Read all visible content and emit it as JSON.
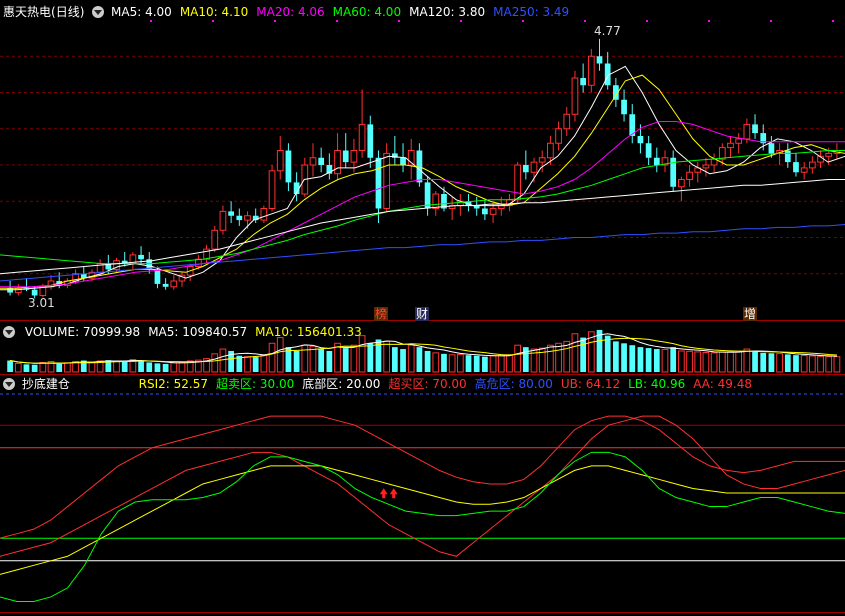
{
  "header": {
    "stock_name": "惠天热电",
    "period": "(日线)",
    "ma_labels": [
      {
        "text": "MA5: 4.00",
        "color": "#ffffff"
      },
      {
        "text": "MA10: 4.10",
        "color": "#ffff00"
      },
      {
        "text": "MA20: 4.06",
        "color": "#ff00ff"
      },
      {
        "text": "MA60: 4.00",
        "color": "#00ff00"
      },
      {
        "text": "MA120: 3.80",
        "color": "#ffffff"
      },
      {
        "text": "MA250: 3.49",
        "color": "#3050ff"
      }
    ]
  },
  "price_annotations": {
    "high": "4.77",
    "low": "3.01"
  },
  "signal_markers": [
    "榜",
    "财",
    "增"
  ],
  "volume_header": [
    {
      "text": "VOLUME: 70999.98",
      "color": "#ffffff"
    },
    {
      "text": "MA5: 109840.57",
      "color": "#ffffff"
    },
    {
      "text": "MA10: 156401.33",
      "color": "#ffff00"
    }
  ],
  "indicator_header": {
    "name": "抄底建仓",
    "items": [
      {
        "text": "RSI2: 52.57",
        "color": "#ffff00"
      },
      {
        "text": "超卖区: 30.00",
        "color": "#00ff00"
      },
      {
        "text": "底部区: 20.00",
        "color": "#ffffff"
      },
      {
        "text": "超买区: 70.00",
        "color": "#ff3030"
      },
      {
        "text": "高危区: 80.00",
        "color": "#3050ff"
      },
      {
        "text": "UB: 64.12",
        "color": "#ff3030"
      },
      {
        "text": "LB: 40.96",
        "color": "#00ff00"
      },
      {
        "text": "AA: 49.48",
        "color": "#ff3030"
      }
    ]
  },
  "icons": [
    "collapse-triangle-icon",
    "buy-signal-arrow-icon"
  ],
  "colors": {
    "up": "#ff3030",
    "down": "#54ffff",
    "background": "#000000",
    "separator": "#a00000"
  },
  "chart_data": {
    "type": "candlestick",
    "price_ylim": [
      2.9,
      4.9
    ],
    "ohlc": [
      [
        3.05,
        3.1,
        3.0,
        3.02
      ],
      [
        3.02,
        3.08,
        3.0,
        3.05
      ],
      [
        3.05,
        3.12,
        3.03,
        3.04
      ],
      [
        3.04,
        3.06,
        2.98,
        3.0
      ],
      [
        3.0,
        3.08,
        2.99,
        3.06
      ],
      [
        3.06,
        3.14,
        3.04,
        3.1
      ],
      [
        3.1,
        3.16,
        3.05,
        3.07
      ],
      [
        3.07,
        3.12,
        3.05,
        3.1
      ],
      [
        3.1,
        3.18,
        3.08,
        3.15
      ],
      [
        3.15,
        3.2,
        3.1,
        3.12
      ],
      [
        3.12,
        3.18,
        3.1,
        3.16
      ],
      [
        3.16,
        3.25,
        3.14,
        3.22
      ],
      [
        3.22,
        3.28,
        3.15,
        3.18
      ],
      [
        3.18,
        3.26,
        3.16,
        3.24
      ],
      [
        3.24,
        3.3,
        3.2,
        3.22
      ],
      [
        3.22,
        3.3,
        3.18,
        3.28
      ],
      [
        3.28,
        3.34,
        3.22,
        3.25
      ],
      [
        3.25,
        3.3,
        3.15,
        3.18
      ],
      [
        3.18,
        3.2,
        3.05,
        3.08
      ],
      [
        3.08,
        3.12,
        3.04,
        3.06
      ],
      [
        3.06,
        3.14,
        3.04,
        3.1
      ],
      [
        3.1,
        3.16,
        3.06,
        3.14
      ],
      [
        3.14,
        3.22,
        3.1,
        3.2
      ],
      [
        3.2,
        3.28,
        3.18,
        3.25
      ],
      [
        3.25,
        3.35,
        3.22,
        3.32
      ],
      [
        3.32,
        3.48,
        3.3,
        3.45
      ],
      [
        3.45,
        3.62,
        3.42,
        3.58
      ],
      [
        3.58,
        3.65,
        3.5,
        3.55
      ],
      [
        3.55,
        3.6,
        3.48,
        3.52
      ],
      [
        3.52,
        3.58,
        3.46,
        3.55
      ],
      [
        3.55,
        3.6,
        3.5,
        3.52
      ],
      [
        3.52,
        3.62,
        3.5,
        3.6
      ],
      [
        3.6,
        3.9,
        3.58,
        3.86
      ],
      [
        3.86,
        4.1,
        3.8,
        4.0
      ],
      [
        4.0,
        4.05,
        3.72,
        3.78
      ],
      [
        3.78,
        3.85,
        3.65,
        3.7
      ],
      [
        3.7,
        3.95,
        3.68,
        3.9
      ],
      [
        3.9,
        4.05,
        3.82,
        3.95
      ],
      [
        3.95,
        4.02,
        3.85,
        3.9
      ],
      [
        3.9,
        3.98,
        3.8,
        3.84
      ],
      [
        3.84,
        4.12,
        3.8,
        4.0
      ],
      [
        4.0,
        4.12,
        3.88,
        3.92
      ],
      [
        3.92,
        4.08,
        3.85,
        4.0
      ],
      [
        4.0,
        4.42,
        3.95,
        4.18
      ],
      [
        4.18,
        4.24,
        3.88,
        3.95
      ],
      [
        3.95,
        4.0,
        3.5,
        3.6
      ],
      [
        3.6,
        4.05,
        3.58,
        3.98
      ],
      [
        3.98,
        4.1,
        3.9,
        3.95
      ],
      [
        3.95,
        4.05,
        3.85,
        3.9
      ],
      [
        3.9,
        4.08,
        3.8,
        4.0
      ],
      [
        4.0,
        4.05,
        3.75,
        3.78
      ],
      [
        3.78,
        3.82,
        3.55,
        3.6
      ],
      [
        3.6,
        3.72,
        3.55,
        3.7
      ],
      [
        3.7,
        3.75,
        3.58,
        3.6
      ],
      [
        3.6,
        3.68,
        3.52,
        3.62
      ],
      [
        3.62,
        3.7,
        3.55,
        3.65
      ],
      [
        3.65,
        3.7,
        3.58,
        3.62
      ],
      [
        3.62,
        3.68,
        3.55,
        3.6
      ],
      [
        3.6,
        3.66,
        3.52,
        3.56
      ],
      [
        3.56,
        3.64,
        3.5,
        3.6
      ],
      [
        3.6,
        3.68,
        3.55,
        3.62
      ],
      [
        3.62,
        3.7,
        3.58,
        3.66
      ],
      [
        3.66,
        3.92,
        3.64,
        3.9
      ],
      [
        3.9,
        4.0,
        3.8,
        3.85
      ],
      [
        3.85,
        3.95,
        3.78,
        3.92
      ],
      [
        3.92,
        4.0,
        3.85,
        3.95
      ],
      [
        3.95,
        4.1,
        3.9,
        4.05
      ],
      [
        4.05,
        4.2,
        4.0,
        4.15
      ],
      [
        4.15,
        4.3,
        4.1,
        4.25
      ],
      [
        4.25,
        4.55,
        4.2,
        4.5
      ],
      [
        4.5,
        4.6,
        4.4,
        4.45
      ],
      [
        4.45,
        4.7,
        4.4,
        4.65
      ],
      [
        4.65,
        4.77,
        4.55,
        4.6
      ],
      [
        4.6,
        4.68,
        4.42,
        4.45
      ],
      [
        4.45,
        4.5,
        4.3,
        4.35
      ],
      [
        4.35,
        4.42,
        4.2,
        4.25
      ],
      [
        4.25,
        4.32,
        4.05,
        4.1
      ],
      [
        4.1,
        4.18,
        3.98,
        4.05
      ],
      [
        4.05,
        4.1,
        3.9,
        3.95
      ],
      [
        3.95,
        4.02,
        3.85,
        3.9
      ],
      [
        3.9,
        4.0,
        3.85,
        3.95
      ],
      [
        3.95,
        4.0,
        3.72,
        3.75
      ],
      [
        3.75,
        3.82,
        3.65,
        3.8
      ],
      [
        3.8,
        3.9,
        3.75,
        3.85
      ],
      [
        3.85,
        3.92,
        3.78,
        3.88
      ],
      [
        3.88,
        3.95,
        3.82,
        3.9
      ],
      [
        3.9,
        3.98,
        3.85,
        3.94
      ],
      [
        3.94,
        4.05,
        3.9,
        4.02
      ],
      [
        4.02,
        4.1,
        3.95,
        4.05
      ],
      [
        4.05,
        4.12,
        3.98,
        4.08
      ],
      [
        4.08,
        4.22,
        4.05,
        4.18
      ],
      [
        4.18,
        4.25,
        4.08,
        4.12
      ],
      [
        4.12,
        4.18,
        4.0,
        4.05
      ],
      [
        4.05,
        4.1,
        3.95,
        3.98
      ],
      [
        3.98,
        4.05,
        3.9,
        4.0
      ],
      [
        4.0,
        4.05,
        3.88,
        3.92
      ],
      [
        3.92,
        3.98,
        3.82,
        3.85
      ],
      [
        3.85,
        3.92,
        3.8,
        3.88
      ],
      [
        3.88,
        3.96,
        3.84,
        3.92
      ],
      [
        3.92,
        4.0,
        3.88,
        3.96
      ],
      [
        3.96,
        4.02,
        3.9,
        3.98
      ],
      [
        3.98,
        4.05,
        3.94,
        4.0
      ]
    ],
    "ma_series": [
      {
        "color": "#ffffff",
        "values": [
          3.04,
          3.04,
          3.05,
          3.06,
          3.08,
          3.12,
          3.15,
          3.2,
          3.22,
          3.2,
          3.16,
          3.12,
          3.16,
          3.24,
          3.4,
          3.52,
          3.56,
          3.6,
          3.8,
          3.82,
          3.88,
          3.88,
          3.92,
          3.96,
          3.95,
          3.85,
          3.75,
          3.66,
          3.62,
          3.62,
          3.62,
          3.7,
          3.88,
          3.96,
          4.1,
          4.3,
          4.52,
          4.58,
          4.4,
          4.18,
          4.0,
          3.9,
          3.84,
          3.86,
          3.92,
          4.02,
          4.08,
          4.06,
          4.0,
          3.92,
          3.96
        ]
      },
      {
        "color": "#ffff00",
        "values": [
          3.05,
          3.05,
          3.06,
          3.07,
          3.1,
          3.12,
          3.14,
          3.16,
          3.18,
          3.18,
          3.17,
          3.16,
          3.2,
          3.26,
          3.32,
          3.42,
          3.5,
          3.56,
          3.66,
          3.74,
          3.8,
          3.84,
          3.86,
          3.9,
          3.9,
          3.88,
          3.82,
          3.75,
          3.7,
          3.65,
          3.62,
          3.64,
          3.74,
          3.84,
          3.96,
          4.12,
          4.3,
          4.48,
          4.52,
          4.42,
          4.25,
          4.08,
          3.96,
          3.9,
          3.9,
          3.94,
          3.98,
          4.02,
          4.04,
          4.0,
          3.98
        ]
      },
      {
        "color": "#ff00ff",
        "values": [
          3.06,
          3.06,
          3.06,
          3.07,
          3.08,
          3.1,
          3.12,
          3.14,
          3.16,
          3.17,
          3.18,
          3.2,
          3.22,
          3.24,
          3.28,
          3.32,
          3.38,
          3.44,
          3.5,
          3.56,
          3.62,
          3.68,
          3.72,
          3.76,
          3.78,
          3.8,
          3.8,
          3.78,
          3.76,
          3.74,
          3.72,
          3.7,
          3.72,
          3.75,
          3.8,
          3.88,
          3.98,
          4.08,
          4.16,
          4.2,
          4.2,
          4.18,
          4.14,
          4.1,
          4.08,
          4.06,
          4.06,
          4.06,
          4.06,
          4.06,
          4.06
        ]
      },
      {
        "color": "#00ff00",
        "values": [
          3.28,
          3.27,
          3.26,
          3.25,
          3.24,
          3.23,
          3.22,
          3.22,
          3.22,
          3.22,
          3.23,
          3.24,
          3.25,
          3.27,
          3.29,
          3.32,
          3.35,
          3.38,
          3.42,
          3.45,
          3.48,
          3.52,
          3.55,
          3.58,
          3.6,
          3.62,
          3.63,
          3.64,
          3.65,
          3.66,
          3.66,
          3.67,
          3.68,
          3.7,
          3.73,
          3.76,
          3.8,
          3.84,
          3.88,
          3.9,
          3.92,
          3.93,
          3.94,
          3.95,
          3.96,
          3.97,
          3.98,
          3.98,
          3.99,
          4.0,
          4.0
        ]
      },
      {
        "color": "#ffffff",
        "values": [
          3.15,
          3.16,
          3.17,
          3.18,
          3.19,
          3.2,
          3.21,
          3.22,
          3.23,
          3.24,
          3.26,
          3.28,
          3.3,
          3.32,
          3.35,
          3.38,
          3.41,
          3.44,
          3.47,
          3.5,
          3.52,
          3.54,
          3.56,
          3.58,
          3.59,
          3.6,
          3.61,
          3.62,
          3.62,
          3.63,
          3.63,
          3.64,
          3.64,
          3.65,
          3.66,
          3.67,
          3.68,
          3.69,
          3.7,
          3.71,
          3.72,
          3.73,
          3.74,
          3.75,
          3.76,
          3.76,
          3.77,
          3.78,
          3.79,
          3.8,
          3.8
        ]
      },
      {
        "color": "#3050ff",
        "values": [
          3.1,
          3.11,
          3.12,
          3.13,
          3.14,
          3.15,
          3.16,
          3.17,
          3.18,
          3.19,
          3.2,
          3.21,
          3.22,
          3.23,
          3.24,
          3.25,
          3.26,
          3.27,
          3.28,
          3.29,
          3.3,
          3.31,
          3.32,
          3.33,
          3.33,
          3.34,
          3.35,
          3.35,
          3.36,
          3.37,
          3.37,
          3.38,
          3.38,
          3.39,
          3.4,
          3.4,
          3.41,
          3.42,
          3.42,
          3.43,
          3.43,
          3.44,
          3.44,
          3.45,
          3.46,
          3.46,
          3.47,
          3.47,
          3.48,
          3.48,
          3.49
        ]
      }
    ],
    "volume": [
      60,
      45,
      40,
      38,
      50,
      55,
      42,
      48,
      55,
      60,
      52,
      58,
      62,
      55,
      60,
      65,
      58,
      50,
      45,
      42,
      48,
      52,
      58,
      62,
      70,
      95,
      120,
      110,
      85,
      80,
      78,
      90,
      150,
      180,
      130,
      110,
      140,
      135,
      120,
      110,
      150,
      125,
      140,
      190,
      150,
      170,
      160,
      130,
      120,
      140,
      130,
      110,
      100,
      95,
      90,
      92,
      88,
      85,
      80,
      84,
      86,
      90,
      140,
      130,
      120,
      125,
      140,
      150,
      160,
      200,
      180,
      210,
      220,
      190,
      160,
      150,
      140,
      130,
      125,
      120,
      118,
      130,
      110,
      108,
      105,
      102,
      100,
      104,
      106,
      108,
      120,
      110,
      100,
      98,
      96,
      92,
      88,
      86,
      84,
      82,
      80,
      80
    ],
    "volume_max": 230,
    "indicator_ylim": [
      0,
      100
    ],
    "indicator_levels": [
      {
        "value": 20,
        "color": "#ffffff"
      },
      {
        "value": 30,
        "color": "#00ff00"
      },
      {
        "value": 70,
        "color": "#ff3030"
      },
      {
        "value": 80,
        "color": "#a00000"
      }
    ],
    "ub_series": {
      "color": "#ff3030",
      "values": [
        30,
        32,
        34,
        38,
        44,
        50,
        56,
        62,
        66,
        70,
        72,
        74,
        76,
        78,
        80,
        82,
        84,
        84,
        84,
        84,
        82,
        80,
        76,
        72,
        68,
        64,
        60,
        57,
        55,
        54,
        54,
        56,
        62,
        70,
        78,
        82,
        84,
        84,
        82,
        78,
        72,
        66,
        62,
        60,
        59,
        60,
        62,
        64,
        64,
        64,
        64
      ]
    },
    "lb_series": {
      "color": "#00ff00",
      "values": [
        4,
        2,
        2,
        4,
        8,
        18,
        32,
        42,
        46,
        47,
        47,
        47,
        48,
        50,
        55,
        62,
        66,
        66,
        64,
        62,
        58,
        52,
        48,
        45,
        42,
        41,
        40,
        40,
        41,
        42,
        42,
        44,
        50,
        58,
        64,
        68,
        68,
        66,
        60,
        52,
        48,
        46,
        44,
        44,
        46,
        48,
        48,
        46,
        44,
        42,
        41
      ]
    },
    "aa_series": {
      "color": "#ff3030",
      "values": [
        22,
        24,
        26,
        28,
        32,
        36,
        40,
        44,
        48,
        52,
        56,
        60,
        62,
        64,
        66,
        68,
        68,
        66,
        62,
        58,
        54,
        48,
        42,
        36,
        32,
        28,
        24,
        22,
        28,
        34,
        40,
        46,
        52,
        58,
        66,
        74,
        80,
        82,
        84,
        84,
        80,
        74,
        66,
        58,
        54,
        52,
        52,
        54,
        56,
        58,
        60
      ]
    },
    "rsi_series": {
      "color": "#ffff00",
      "values": [
        14,
        16,
        18,
        20,
        22,
        26,
        30,
        34,
        38,
        42,
        46,
        50,
        54,
        56,
        58,
        60,
        62,
        62,
        62,
        62,
        60,
        58,
        56,
        54,
        52,
        50,
        48,
        46,
        45,
        45,
        46,
        48,
        52,
        56,
        60,
        62,
        62,
        60,
        58,
        56,
        54,
        52,
        51,
        50,
        50,
        50,
        50,
        50,
        50,
        50,
        50
      ]
    },
    "buy_signal_index": 23
  }
}
